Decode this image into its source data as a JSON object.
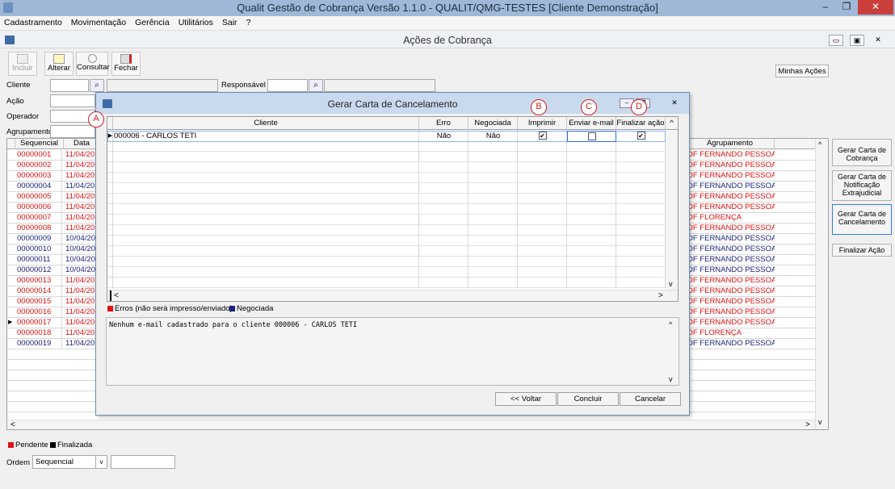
{
  "window": {
    "title": "Qualit Gestão de Cobrança Versão 1.1.0 - QUALIT/QMG-TESTES [Cliente Demonstração]",
    "min": "–",
    "max": "❐",
    "close": "✕"
  },
  "menu": [
    "Cadastramento",
    "Movimentação",
    "Gerência",
    "Utilitários",
    "Sair",
    "?"
  ],
  "child": {
    "title": "Ações de Cobrança"
  },
  "toolbar": {
    "incluir": "Incluir",
    "alterar": "Alterar",
    "consultar": "Consultar",
    "fechar": "Fechar",
    "minhas_acoes": "Minhas Ações"
  },
  "filters": {
    "cliente": "Cliente",
    "responsavel": "Responsável",
    "acao": "Ação",
    "operador": "Operador",
    "agrupamento": "Agrupamento"
  },
  "grid": {
    "headers": {
      "sequencial": "Sequencial",
      "data": "Data",
      "agrupamento": "Agrupamento"
    },
    "rows": [
      {
        "seq": "00000001",
        "date": "11/04/2019",
        "group": "DF FERNANDO PESSOA",
        "color": "red"
      },
      {
        "seq": "00000002",
        "date": "11/04/2019",
        "group": "DF FERNANDO PESSOA",
        "color": "red"
      },
      {
        "seq": "00000003",
        "date": "11/04/2019",
        "group": "DF FERNANDO PESSOA",
        "color": "red"
      },
      {
        "seq": "00000004",
        "date": "11/04/2019",
        "group": "DF FERNANDO PESSOA",
        "color": "blue"
      },
      {
        "seq": "00000005",
        "date": "11/04/2019",
        "group": "DF FERNANDO PESSOA",
        "color": "red"
      },
      {
        "seq": "00000006",
        "date": "11/04/2019",
        "group": "DF FERNANDO PESSOA",
        "color": "red"
      },
      {
        "seq": "00000007",
        "date": "11/04/2019",
        "group": "DF FLORENÇA",
        "color": "red"
      },
      {
        "seq": "00000008",
        "date": "11/04/2019",
        "group": "DF FERNANDO PESSOA",
        "color": "red"
      },
      {
        "seq": "00000009",
        "date": "10/04/2019",
        "group": "DF FERNANDO PESSOA",
        "color": "blue"
      },
      {
        "seq": "00000010",
        "date": "10/04/2019",
        "group": "DF FERNANDO PESSOA",
        "color": "blue"
      },
      {
        "seq": "00000011",
        "date": "10/04/2019",
        "group": "DF FERNANDO PESSOA",
        "color": "blue"
      },
      {
        "seq": "00000012",
        "date": "10/04/2019",
        "group": "DF FERNANDO PESSOA",
        "color": "blue"
      },
      {
        "seq": "00000013",
        "date": "11/04/2019",
        "group": "DF FERNANDO PESSOA",
        "color": "red"
      },
      {
        "seq": "00000014",
        "date": "11/04/2019",
        "group": "DF FERNANDO PESSOA",
        "color": "red"
      },
      {
        "seq": "00000015",
        "date": "11/04/2019",
        "group": "DF FERNANDO PESSOA",
        "color": "red"
      },
      {
        "seq": "00000016",
        "date": "11/04/2019",
        "group": "DF FERNANDO PESSOA",
        "color": "red"
      },
      {
        "seq": "00000017",
        "date": "11/04/2019",
        "group": "DF FERNANDO PESSOA",
        "color": "red"
      },
      {
        "seq": "00000018",
        "date": "11/04/2019",
        "group": "DF FLORENÇA",
        "color": "red"
      },
      {
        "seq": "00000019",
        "date": "11/04/2019",
        "group": "DF FERNANDO PESSOA",
        "color": "blue"
      }
    ]
  },
  "side_buttons": [
    "Gerar Carta de Cobrança",
    "Gerar Carta de Notificação Extrajudicial",
    "Gerar Carta de Cancelamento",
    "Finalizar Ação"
  ],
  "legend": {
    "pendente": "Pendente",
    "finalizada": "Finalizada"
  },
  "order": {
    "label": "Ordem",
    "value": "Sequencial"
  },
  "dialog": {
    "title": "Gerar Carta de Cancelamento",
    "headers": {
      "cliente": "Cliente",
      "erro": "Erro",
      "negociada": "Negociada",
      "imprimir": "Imprimir",
      "enviar": "Enviar e-mail",
      "finalizar": "Finalizar ação"
    },
    "row": {
      "cliente": "000006 - CARLOS TETI",
      "erro": "Não",
      "negociada": "Não",
      "imprimir": true,
      "enviar": false,
      "finalizar": true
    },
    "legend": {
      "erros": "Erros (não será impresso/enviado)",
      "negociada": "Negociada"
    },
    "message": "Nenhum e-mail cadastrado para o cliente 000006 - CARLOS TETI",
    "buttons": {
      "voltar": "<< Voltar",
      "concluir": "Concluir",
      "cancelar": "Cancelar"
    },
    "callouts": [
      "A",
      "B",
      "C",
      "D"
    ]
  },
  "colors": {
    "red": "#e01010",
    "blue": "#1a237e"
  }
}
